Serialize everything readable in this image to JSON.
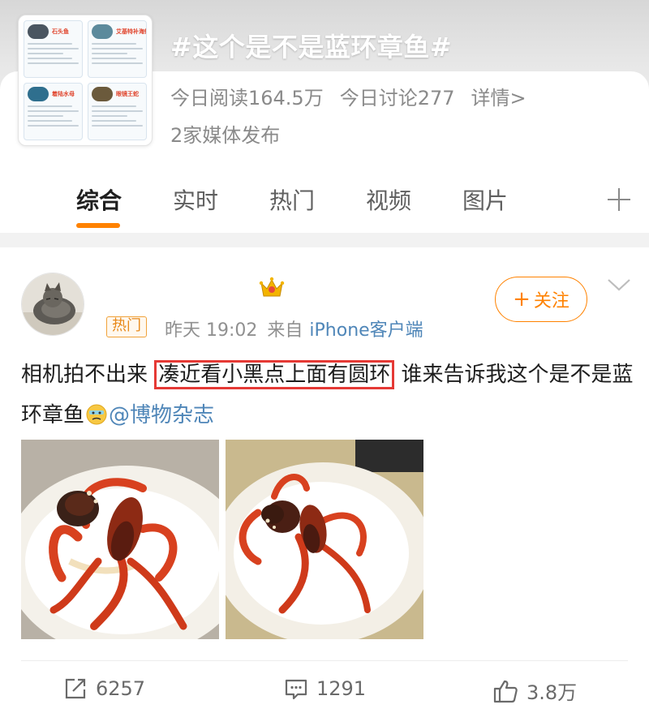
{
  "topic": {
    "title": "#这个是不是蓝环章鱼#",
    "reads_today": "今日阅读164.5万",
    "discussion_today": "今日讨论277",
    "details_link": "详情>",
    "media_count": "2家媒体发布",
    "thumbnail_cards": [
      {
        "title": "石头鱼",
        "photo_color": "#4a5560"
      },
      {
        "title": "艾基特补海蛇",
        "photo_color": "#5c8a9c"
      },
      {
        "title": "着陆水母",
        "photo_color": "#2f6f8e"
      },
      {
        "title": "眼镜王蛇",
        "photo_color": "#6b5a3c"
      }
    ]
  },
  "tabs": [
    {
      "label": "综合",
      "active": true
    },
    {
      "label": "实时",
      "active": false
    },
    {
      "label": "热门",
      "active": false
    },
    {
      "label": "视频",
      "active": false
    },
    {
      "label": "图片",
      "active": false
    }
  ],
  "post": {
    "hot_badge": "热门",
    "time": "昨天 19:02",
    "source_prefix": "来自",
    "device": "iPhone客户端",
    "follow_label": "关注",
    "text_before": "相机拍不出来 ",
    "text_highlight": "凑近看小黑点上面有圆环",
    "text_after": " 谁来告诉我这个是不是蓝环章鱼",
    "emoji": "sweat-face-emoji",
    "mention": "@博物杂志"
  },
  "actions": {
    "repost_count": "6257",
    "comment_count": "1291",
    "like_count": "3.8万"
  },
  "colors": {
    "accent": "#ff8200",
    "link": "#4f86b8",
    "highlight_border": "#e53935"
  }
}
